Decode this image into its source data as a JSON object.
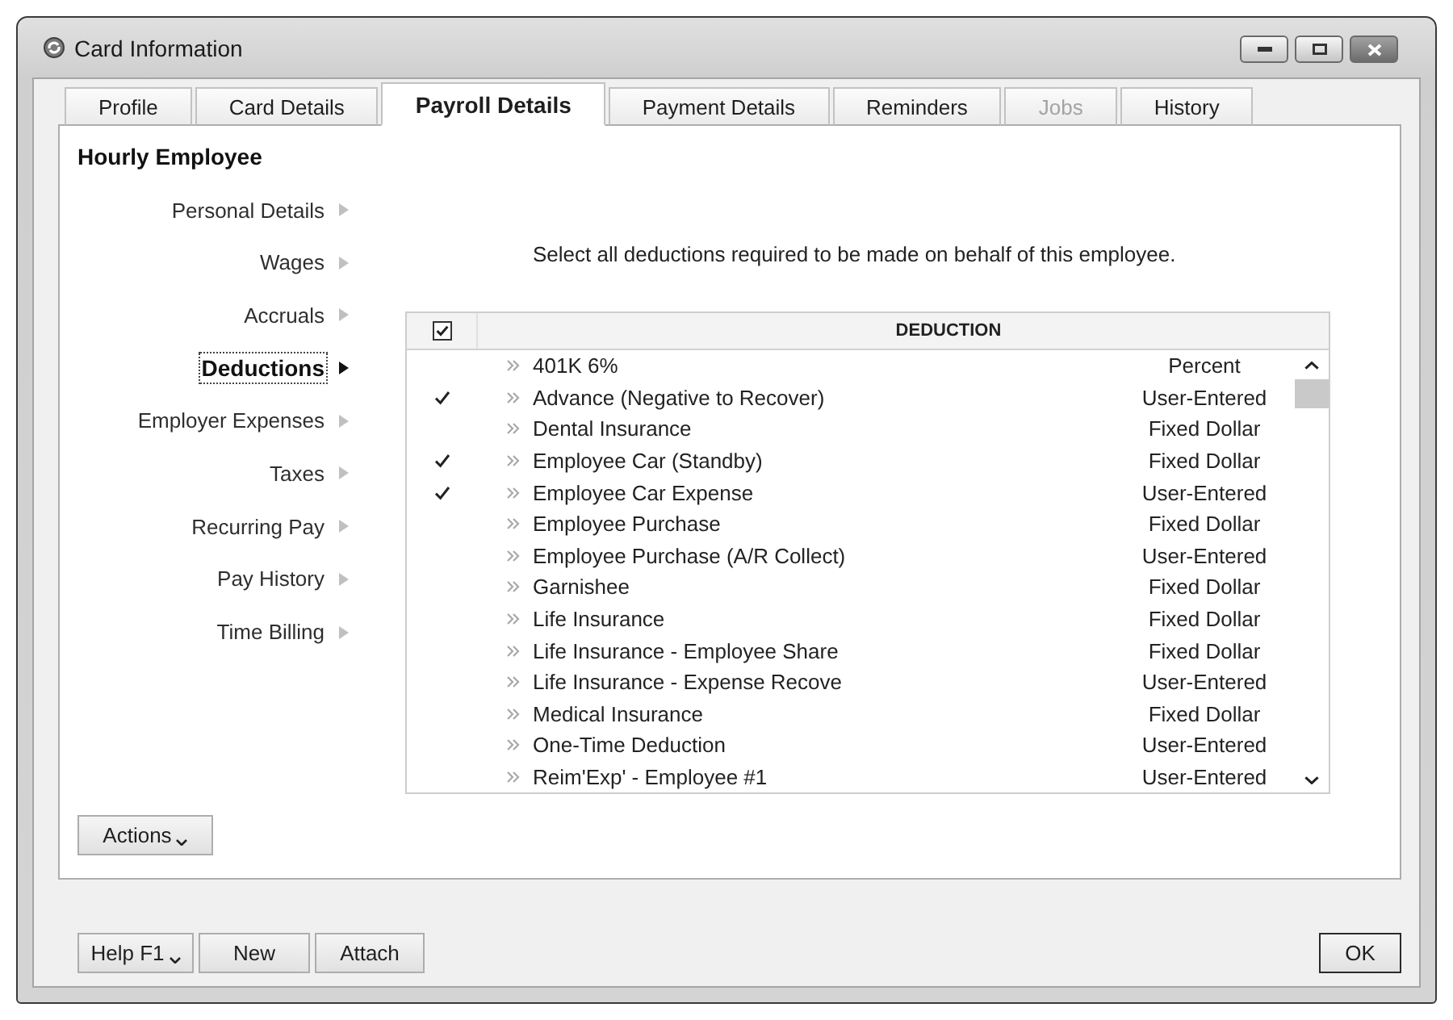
{
  "window": {
    "title": "Card Information"
  },
  "tabs": [
    {
      "label": "Profile",
      "selected": false,
      "disabled": false
    },
    {
      "label": "Card Details",
      "selected": false,
      "disabled": false
    },
    {
      "label": "Payroll Details",
      "selected": true,
      "disabled": false
    },
    {
      "label": "Payment Details",
      "selected": false,
      "disabled": false
    },
    {
      "label": "Reminders",
      "selected": false,
      "disabled": false
    },
    {
      "label": "Jobs",
      "selected": false,
      "disabled": true
    },
    {
      "label": "History",
      "selected": false,
      "disabled": false
    }
  ],
  "card_type": "Hourly Employee",
  "sidebar": {
    "items": [
      {
        "label": "Personal Details",
        "selected": false
      },
      {
        "label": "Wages",
        "selected": false
      },
      {
        "label": "Accruals",
        "selected": false
      },
      {
        "label": "Deductions",
        "selected": true
      },
      {
        "label": "Employer Expenses",
        "selected": false
      },
      {
        "label": "Taxes",
        "selected": false
      },
      {
        "label": "Recurring Pay",
        "selected": false
      },
      {
        "label": "Pay History",
        "selected": false
      },
      {
        "label": "Time Billing",
        "selected": false
      }
    ]
  },
  "instruction": "Select all deductions required to be made on behalf of this employee.",
  "table": {
    "heading": "DEDUCTION",
    "rows": [
      {
        "checked": false,
        "deduction": "401K 6%",
        "column_3": "Percent"
      },
      {
        "checked": true,
        "deduction": "Advance (Negative to Recover)",
        "column_3": "User-Entered"
      },
      {
        "checked": false,
        "deduction": "Dental Insurance",
        "column_3": "Fixed Dollar"
      },
      {
        "checked": true,
        "deduction": "Employee Car (Standby)",
        "column_3": "Fixed Dollar"
      },
      {
        "checked": true,
        "deduction": "Employee Car Expense",
        "column_3": "User-Entered"
      },
      {
        "checked": false,
        "deduction": "Employee Purchase",
        "column_3": "Fixed Dollar"
      },
      {
        "checked": false,
        "deduction": "Employee Purchase (A/R Collect)",
        "column_3": "User-Entered"
      },
      {
        "checked": false,
        "deduction": "Garnishee",
        "column_3": "Fixed Dollar"
      },
      {
        "checked": false,
        "deduction": "Life Insurance",
        "column_3": "Fixed Dollar"
      },
      {
        "checked": false,
        "deduction": "Life Insurance - Employee Share",
        "column_3": "Fixed Dollar"
      },
      {
        "checked": false,
        "deduction": "Life Insurance - Expense Recove",
        "column_3": "User-Entered"
      },
      {
        "checked": false,
        "deduction": "Medical Insurance",
        "column_3": "Fixed Dollar"
      },
      {
        "checked": false,
        "deduction": "One-Time Deduction",
        "column_3": "User-Entered"
      },
      {
        "checked": false,
        "deduction": "Reim'Exp' - Employee #1",
        "column_3": "User-Entered"
      }
    ]
  },
  "actions_button": {
    "label": "Actions",
    "dropdown": true
  },
  "footer_buttons": [
    {
      "label": "Help F1",
      "dropdown": true
    },
    {
      "label": "New",
      "dropdown": false
    },
    {
      "label": "Attach",
      "dropdown": false
    }
  ],
  "ok_button": {
    "label": "OK"
  }
}
